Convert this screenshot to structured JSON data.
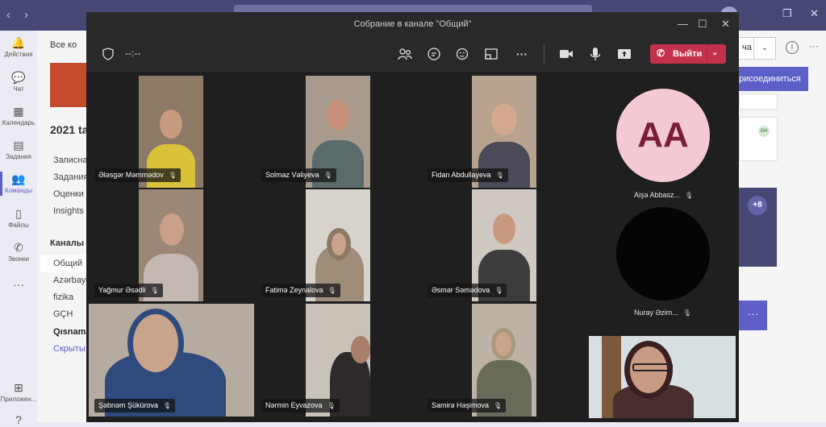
{
  "teams_shell": {
    "nav_back": "‹",
    "nav_forward": "›",
    "window_restore": "❐",
    "window_close": "✕",
    "rail": [
      {
        "label": "Действия",
        "icon": "bell-icon",
        "glyph": "🔔"
      },
      {
        "label": "Чат",
        "icon": "chat-icon",
        "glyph": "💬"
      },
      {
        "label": "Календарь",
        "icon": "calendar-icon",
        "glyph": "▦"
      },
      {
        "label": "Задания",
        "icon": "assignments-icon",
        "glyph": "▤"
      },
      {
        "label": "Команды",
        "icon": "teams-icon",
        "glyph": "👥"
      },
      {
        "label": "Файлы",
        "icon": "files-icon",
        "glyph": "▯"
      },
      {
        "label": "Звонки",
        "icon": "phone-icon",
        "glyph": "✆"
      },
      {
        "label": "",
        "icon": "more-icon",
        "glyph": "···"
      },
      {
        "label": "Приложен...",
        "icon": "apps-icon",
        "glyph": "⊞"
      },
      {
        "label": "",
        "icon": "help-icon",
        "glyph": "?"
      }
    ],
    "left_panel": {
      "back_label": "Все ко",
      "team_name": "2021 ta",
      "nav_items": [
        "Записна",
        "Задания",
        "Оценки",
        "Insights"
      ],
      "channels_header": "Каналы",
      "channels": [
        "Общий",
        "Azərbayc",
        "fizika",
        "GÇH",
        "Qısnama",
        "Скрыты"
      ]
    },
    "right_panel": {
      "dropdown_value": "ча",
      "dropdown_caret": "⌄",
      "info_glyph": "i",
      "more_glyph": "···",
      "join_button": "рисоединиться",
      "badge": "GH",
      "overflow_count": "+8",
      "ellipsis_button": "···"
    }
  },
  "meeting": {
    "window_title": "Собрание в канале \"Общий\"",
    "window_controls": {
      "minimize": "—",
      "maximize": "☐",
      "close": "✕"
    },
    "timer": "--:--",
    "toolbar": {
      "leave_label": "Выйти",
      "leave_icon": "✆",
      "leave_caret": "⌄",
      "more_glyph": "···"
    },
    "mic_glyph": "🎙",
    "participants": [
      {
        "name": "Ələsgər Məmmədov",
        "muted": true
      },
      {
        "name": "Solmaz Vəliyeva",
        "muted": true
      },
      {
        "name": "Fidan Abdullayeva",
        "muted": true
      },
      {
        "name": "Yağmur Əsədli",
        "muted": true
      },
      {
        "name": "Fatimə Zeynalova",
        "muted": true
      },
      {
        "name": "Əsmər Səmədova",
        "muted": true
      },
      {
        "name": "Şəbnəm Şükürova",
        "muted": true
      },
      {
        "name": "Nərmin Eyvazova",
        "muted": true
      },
      {
        "name": "Samirə Həşimova",
        "muted": true
      }
    ],
    "side_participants": [
      {
        "name": "Aişə Abbasz...",
        "initials": "AA",
        "avatar_color": "#f3c9d3",
        "initials_color": "#7a1e3a",
        "muted": true
      },
      {
        "name": "Nuray Əzim...",
        "initials": "",
        "avatar_color": "#050505",
        "muted": true
      }
    ]
  }
}
